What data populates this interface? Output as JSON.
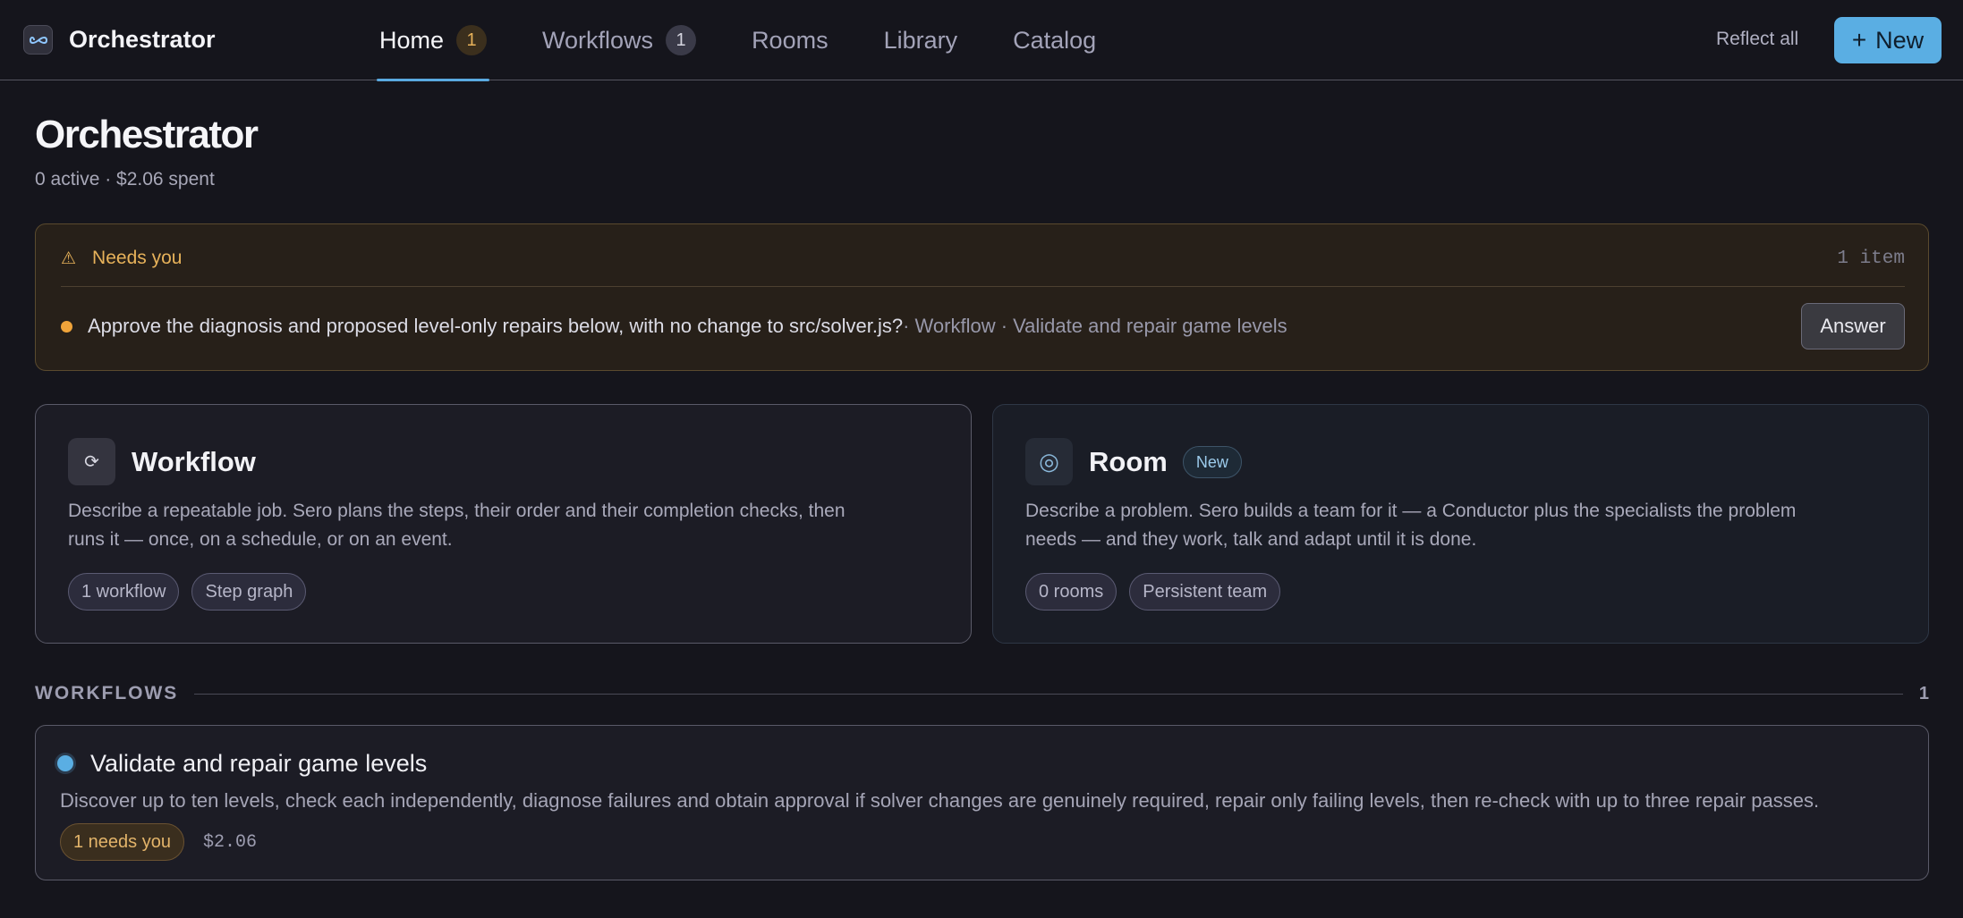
{
  "app": {
    "brand_name": "Orchestrator",
    "logo_icon": "infinity-icon",
    "accent_color": "#5aaee3"
  },
  "nav": {
    "tabs": [
      {
        "label": "Home",
        "badge": "1",
        "active": true
      },
      {
        "label": "Workflows",
        "badge": "1",
        "active": false
      },
      {
        "label": "Rooms",
        "badge": null,
        "active": false
      },
      {
        "label": "Library",
        "badge": null,
        "active": false
      },
      {
        "label": "Catalog",
        "badge": null,
        "active": false
      }
    ],
    "reflect_label": "Reflect all",
    "new_label": "New"
  },
  "header": {
    "title": "Orchestrator",
    "subtitle": "0 active · $2.06 spent"
  },
  "needs_you": {
    "title": "Needs you",
    "count": "1 item",
    "item_question": "Approve the diagnosis and proposed level-only repairs below, with no change to src/solver.js?",
    "item_meta": " · Workflow · Validate and repair game levels",
    "answer_label": "Answer"
  },
  "cards": {
    "workflow": {
      "icon": "loop-icon",
      "title": "Workflow",
      "description": "Describe a repeatable job. Sero plans the steps, their order and their completion checks, then runs it — once, on a schedule, or on an event.",
      "chips": [
        "1 workflow",
        "Step graph"
      ]
    },
    "room": {
      "icon": "target-icon",
      "title": "Room",
      "new_badge": "New",
      "description": "Describe a problem. Sero builds a team for it — a Conductor plus the specialists the problem needs — and they work, talk and adapt until it is done.",
      "chips": [
        "0 rooms",
        "Persistent team"
      ]
    }
  },
  "workflows_section": {
    "label": "WORKFLOWS",
    "count": "1",
    "items": [
      {
        "title": "Validate and repair game levels",
        "description": "Discover up to ten levels, check each independently, diagnose failures and obtain approval if solver changes are genuinely required, repair only failing levels, then re-check with up to three repair passes.",
        "needs_label": "1 needs you",
        "cost": "$2.06"
      }
    ]
  }
}
